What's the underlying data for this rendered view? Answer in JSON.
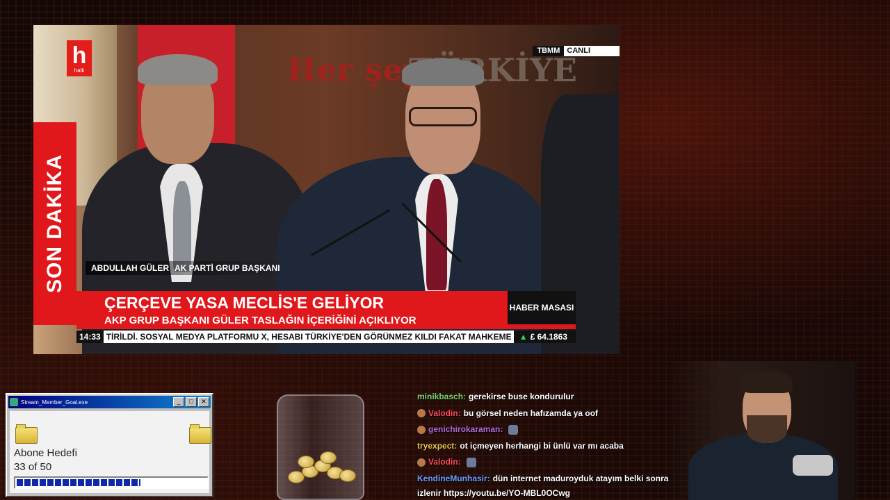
{
  "video": {
    "channel_logo": {
      "letter": "h",
      "text": "halk"
    },
    "live_source": "TBMM",
    "live_label": "CANLI",
    "wall_text_left": "Her şey",
    "wall_text_right": "TÜRKİYE",
    "breaking_tag": "SON DAKİKA",
    "speaker_name": "ABDULLAH GÜLER",
    "speaker_title": "AK PARTİ GRUP BAŞKANI",
    "headline": "ÇERÇEVE YASA MECLİS'E GELİYOR",
    "subheadline": "AKP GRUP BAŞKANI GÜLER TASLAĞIN İÇERİĞİNİ AÇIKLIYOR",
    "program": "HABER MASASI",
    "clock": "14:33",
    "ticker": "TİRİLDİ. SOSYAL MEDYA PLATFORMU X, HESABI TÜRKİYE'DEN GÖRÜNMEZ KILDI FAKAT MAHKEME KARAR",
    "fx": "£ 64.1863",
    "fx_trend": "up"
  },
  "goal_window": {
    "title": "Stream_Member_Goal.exe",
    "label": "Abone Hedefi",
    "progress_text": "33 of 50",
    "current": 33,
    "target": 50,
    "progress_fraction": 0.66,
    "buttons": {
      "minimize": "_",
      "maximize": "□",
      "close": "✕"
    }
  },
  "chat": {
    "messages": [
      {
        "user": "minikbasch",
        "color": "#7cd26b",
        "text": "gerekirse buse kondurulur",
        "badge": false,
        "emote": false
      },
      {
        "user": "Valodin",
        "color": "#ff4a5a",
        "text": "bu görsel neden hafızamda ya oof",
        "badge": true,
        "emote": false
      },
      {
        "user": "genichirokaraman",
        "color": "#b06bd6",
        "text": "",
        "badge": true,
        "emote": true
      },
      {
        "user": "tryexpect",
        "color": "#e8c74a",
        "text": "ot içmeyen herhangi bi ünlü var mı acaba",
        "badge": false,
        "emote": false
      },
      {
        "user": "Valodin",
        "color": "#ff4a5a",
        "text": "",
        "badge": true,
        "emote": true
      },
      {
        "user": "KendineMunhasir",
        "color": "#6a9cff",
        "text": "dün internet maduroyduk atayım belki sonra",
        "badge": false,
        "emote": false
      }
    ],
    "continuation": "izlenir https://youtu.be/YO-MBL0OCwg"
  },
  "colors": {
    "news_red": "#e0171b",
    "win_title": "#00007c",
    "progress": "#0f28a8"
  }
}
